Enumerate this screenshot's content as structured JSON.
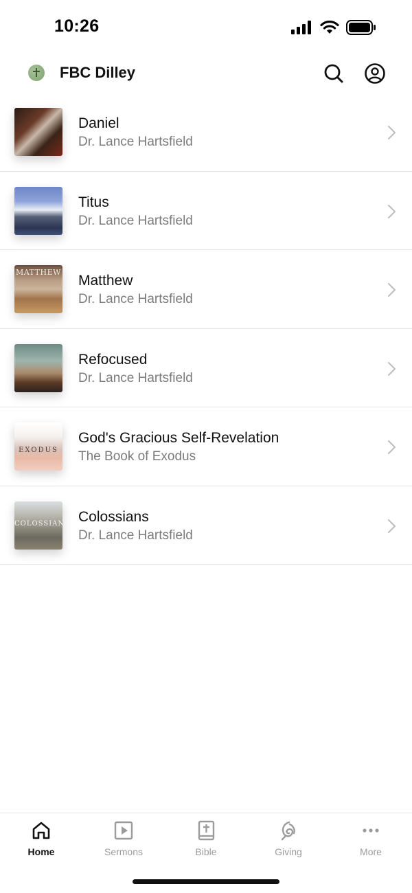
{
  "status_bar": {
    "time": "10:26"
  },
  "header": {
    "title": "FBC Dilley",
    "search_icon": "search-icon",
    "account_icon": "account-icon"
  },
  "series": [
    {
      "title": "Daniel",
      "subtitle": "Dr. Lance Hartsfield",
      "thumb_text": ""
    },
    {
      "title": "Titus",
      "subtitle": "Dr. Lance Hartsfield",
      "thumb_text": ""
    },
    {
      "title": "Matthew",
      "subtitle": "Dr. Lance Hartsfield",
      "thumb_text": "MATTHEW"
    },
    {
      "title": "Refocused",
      "subtitle": "Dr. Lance Hartsfield",
      "thumb_text": ""
    },
    {
      "title": "God's Gracious Self-Revelation",
      "subtitle": "The Book of Exodus",
      "thumb_text": "EXODUS"
    },
    {
      "title": "Colossians",
      "subtitle": "Dr. Lance Hartsfield",
      "thumb_text": "COLOSSIANS"
    }
  ],
  "tabs": [
    {
      "label": "Home",
      "icon": "home-icon",
      "active": true
    },
    {
      "label": "Sermons",
      "icon": "play-icon",
      "active": false
    },
    {
      "label": "Bible",
      "icon": "bible-icon",
      "active": false
    },
    {
      "label": "Giving",
      "icon": "giving-icon",
      "active": false
    },
    {
      "label": "More",
      "icon": "more-icon",
      "active": false
    }
  ],
  "colors": {
    "text_primary": "#111111",
    "text_secondary": "#7b7b7b",
    "tab_inactive": "#9b9b9b",
    "divider": "#e4e4e4"
  }
}
